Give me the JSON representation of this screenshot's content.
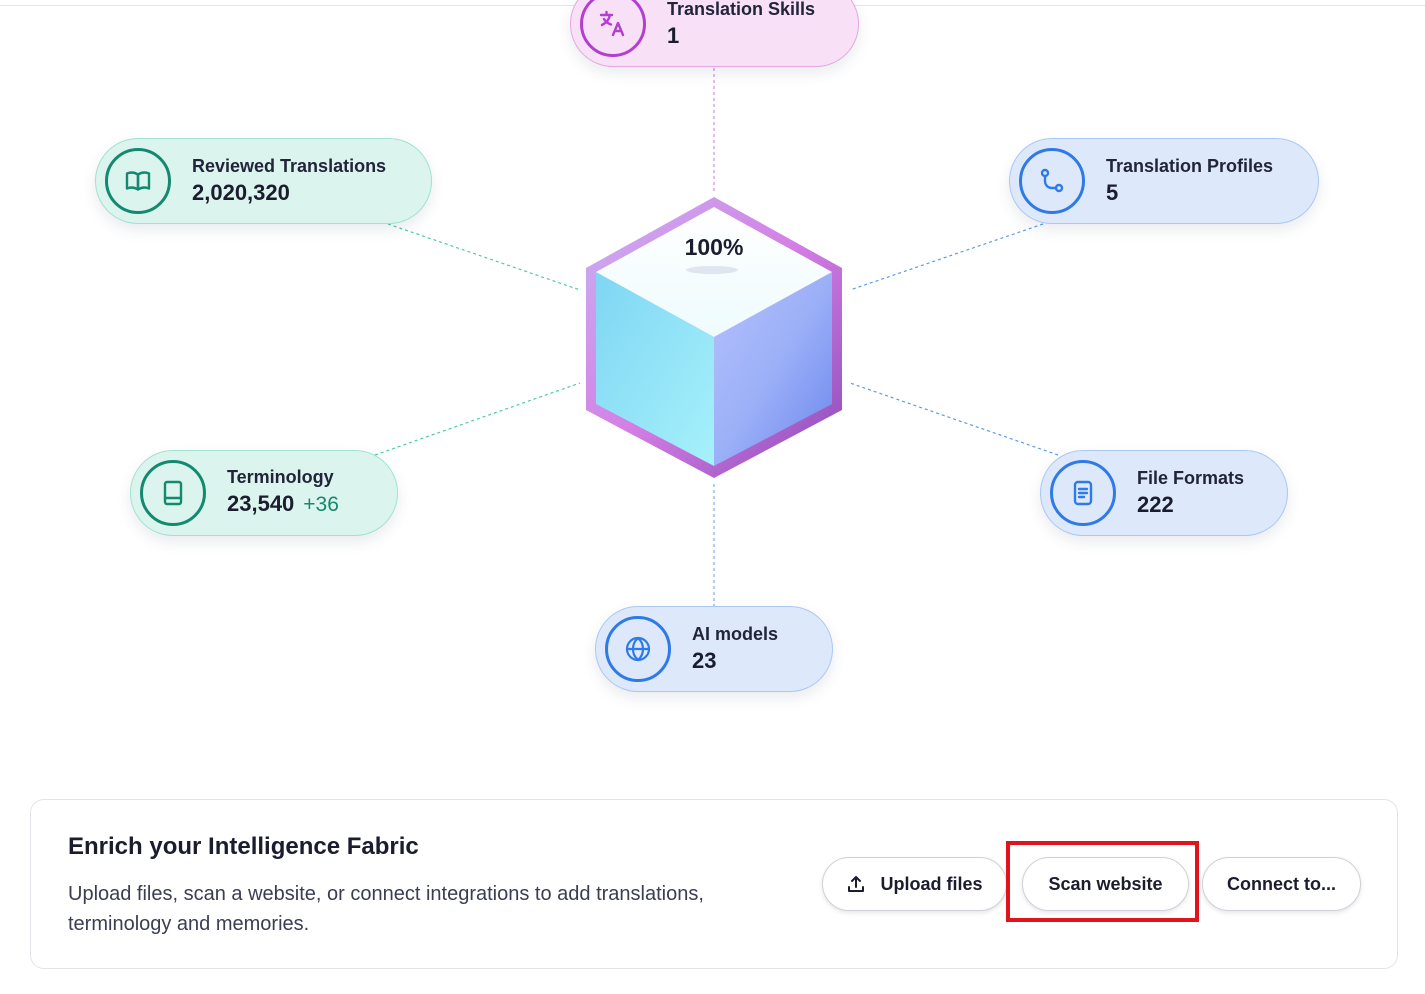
{
  "nodes": {
    "translation_skills": {
      "label": "Translation Skills",
      "value": "1",
      "icon": "translate-icon",
      "color": "#b23fd0"
    },
    "reviewed_translations": {
      "label": "Reviewed Translations",
      "value": "2,020,320",
      "icon": "book-open-icon",
      "color": "#13896f"
    },
    "translation_profiles": {
      "label": "Translation Profiles",
      "value": "5",
      "icon": "route-icon",
      "color": "#2f7ae7"
    },
    "terminology": {
      "label": "Terminology",
      "value": "23,540",
      "delta": "+36",
      "icon": "book-icon",
      "color": "#13896f"
    },
    "file_formats": {
      "label": "File Formats",
      "value": "222",
      "icon": "document-icon",
      "color": "#2f7ae7"
    },
    "ai_models": {
      "label": "AI models",
      "value": "23",
      "icon": "globe-icon",
      "color": "#2f7ae7"
    }
  },
  "fabric": {
    "completion": "100%"
  },
  "enrich_panel": {
    "title": "Enrich your Intelligence Fabric",
    "description": "Upload files, scan a website, or connect integrations to add translations, terminology and memories.",
    "buttons": {
      "upload": {
        "label": "Upload files",
        "icon": "upload-icon"
      },
      "scan": {
        "label": "Scan website"
      },
      "connect": {
        "label": "Connect to..."
      }
    }
  },
  "highlight_color": "#e1141b"
}
